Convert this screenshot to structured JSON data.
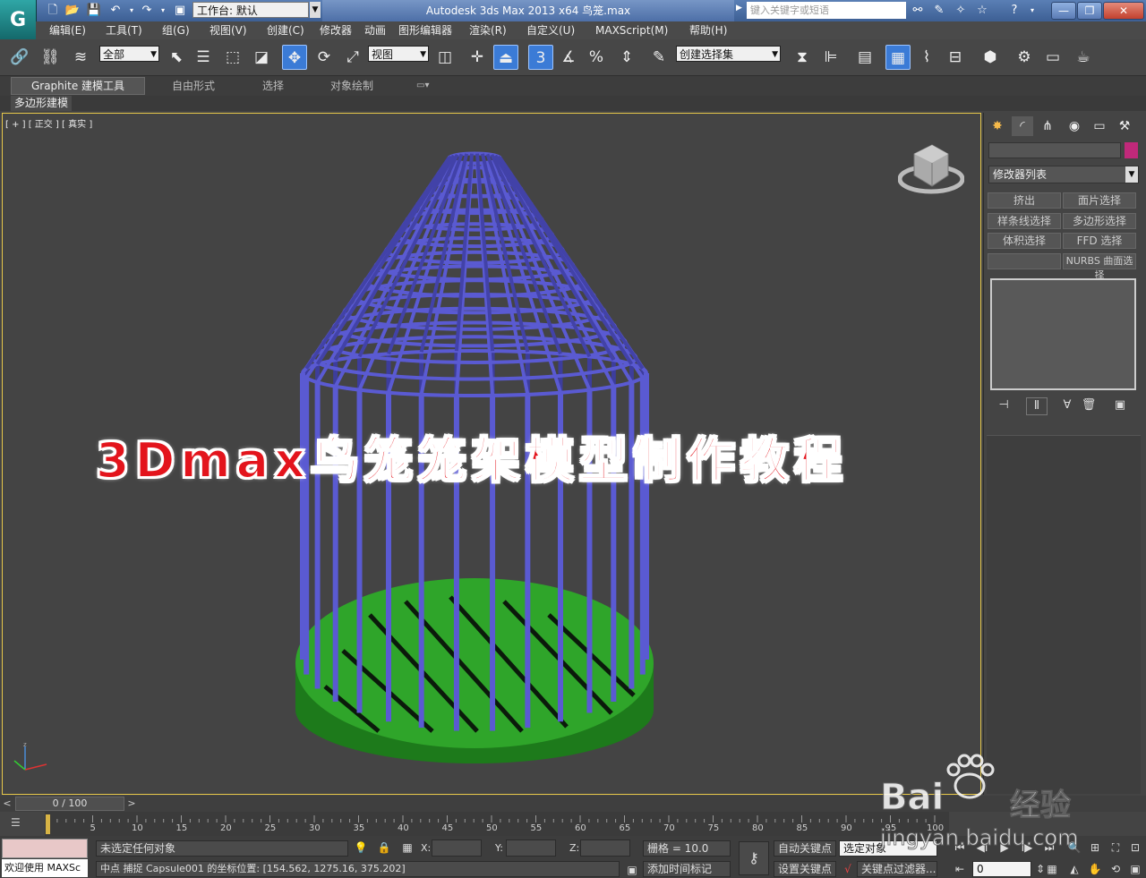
{
  "app": {
    "title": "Autodesk 3ds Max  2013 x64      鸟笼.max",
    "workspace_label": "工作台: 默认",
    "search_placeholder": "键入关键字或短语",
    "window_buttons": [
      "—",
      "❐",
      "✕"
    ]
  },
  "menu": [
    "编辑(E)",
    "工具(T)",
    "组(G)",
    "视图(V)",
    "创建(C)",
    "修改器",
    "动画",
    "图形编辑器",
    "渲染(R)",
    "自定义(U)",
    "MAXScript(M)",
    "帮助(H)"
  ],
  "toolbar": {
    "selection_filter": "全部",
    "ref_coord": "视图",
    "named_selection_placeholder": "创建选择集",
    "snap_label": "3"
  },
  "ribbon": {
    "tabs": [
      "Graphite 建模工具",
      "自由形式",
      "选择",
      "对象绘制"
    ],
    "subtab": "多边形建模"
  },
  "viewport": {
    "label": "[ + ] [ 正交 ] [ 真实 ]",
    "overlay_title": "3Dmax鸟笼笼架模型制作教程",
    "cage_color": "#5a5ad2",
    "base_color": "#2fa52a",
    "border_color": "#e7c84a"
  },
  "command_panel": {
    "modifier_list": "修改器列表",
    "object_color": "#c0297a",
    "buttons": [
      "挤出",
      "面片选择",
      "样条线选择",
      "多边形选择",
      "体积选择",
      "FFD 选择",
      "",
      "NURBS 曲面选择"
    ]
  },
  "timeline": {
    "frame_display": "0 / 100",
    "ticks": [
      "0",
      "5",
      "10",
      "15",
      "20",
      "25",
      "30",
      "35",
      "40",
      "45",
      "50",
      "55",
      "60",
      "65",
      "70",
      "75",
      "80",
      "85",
      "90",
      "95",
      "100"
    ]
  },
  "status": {
    "welcome": "欢迎使用 MAXSc",
    "selection_status": "未选定任何对象",
    "prompt": "中点 捕捉 Capsule001 的坐标位置: [154.562, 1275.16, 375.202]",
    "x_label": "X:",
    "y_label": "Y:",
    "z_label": "Z:",
    "grid": "栅格 = 10.0",
    "add_time_tag": "添加时间标记",
    "auto_key": "自动关键点",
    "set_key": "设置关键点",
    "key_mode_select": "选定对象",
    "key_filters": "关键点过滤器...",
    "current_frame": "0"
  },
  "watermark": {
    "brand": "Bai",
    "brand_suffix": "经验",
    "url": "jingyan.baidu.com"
  }
}
